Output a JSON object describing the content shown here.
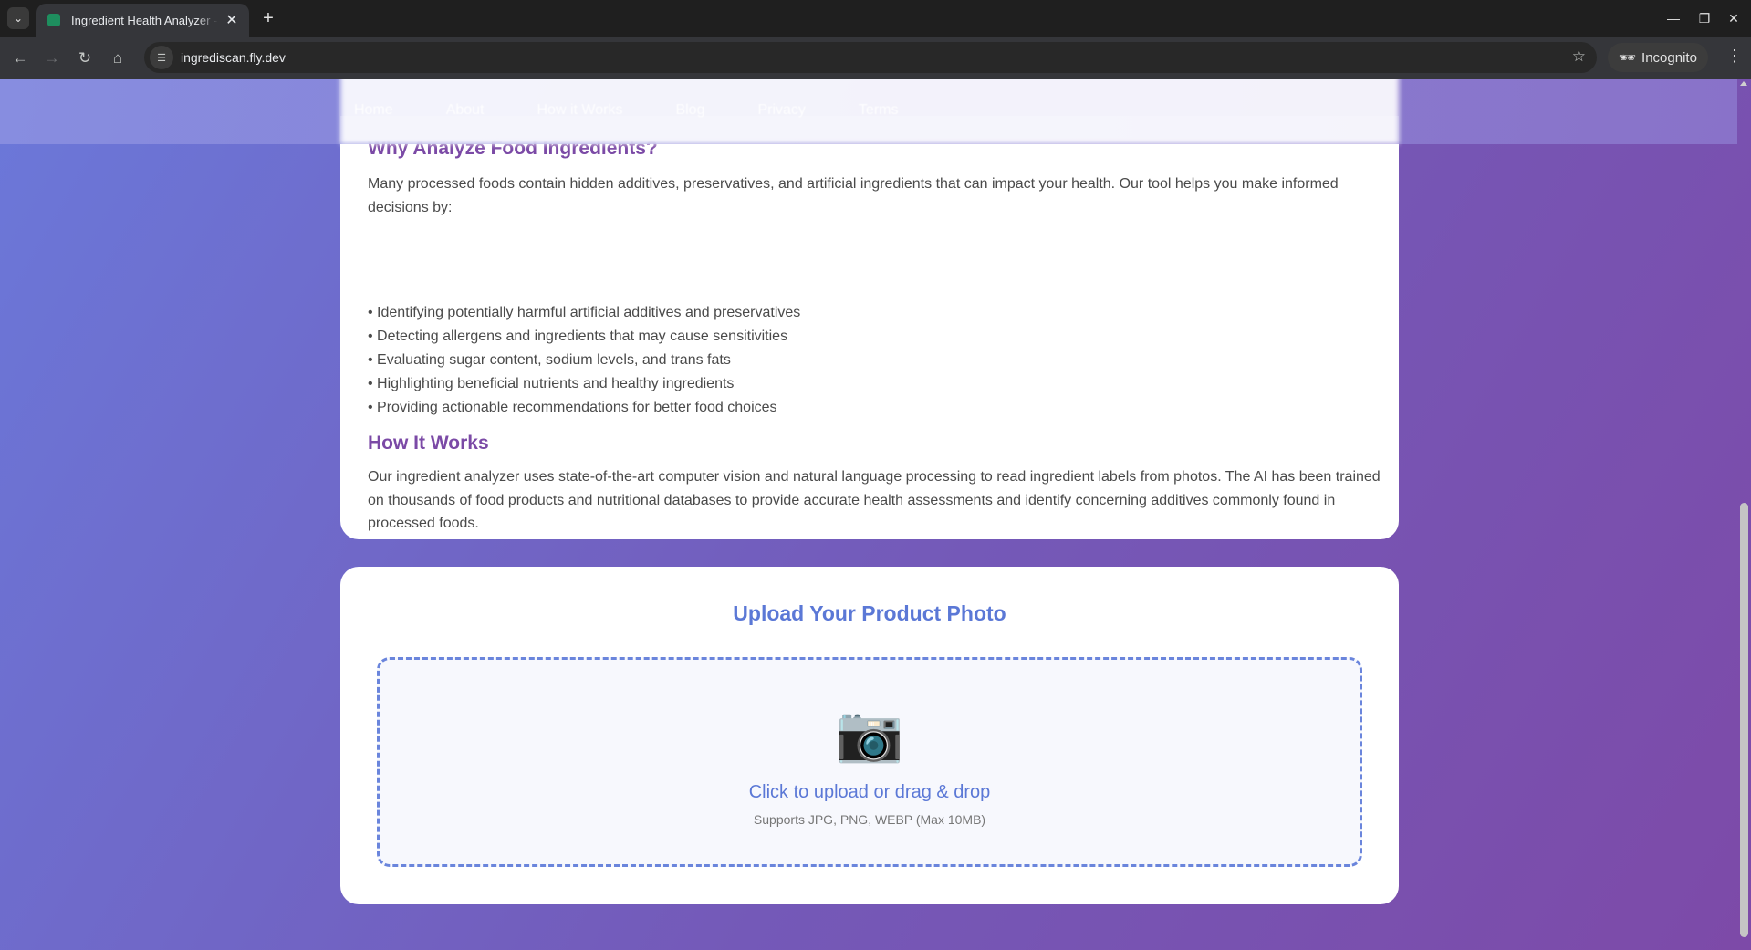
{
  "browser": {
    "tab_title": "Ingredient Health Analyzer - ",
    "url": "ingrediscan.fly.dev",
    "incognito_label": "Incognito"
  },
  "nav": {
    "links": [
      "Home",
      "About",
      "How it Works",
      "Blog",
      "Privacy",
      "Terms"
    ]
  },
  "info": {
    "why_title": "Why Analyze Food Ingredients?",
    "why_intro": "Many processed foods contain hidden additives, preservatives, and artificial ingredients that can impact your health. Our tool helps you make informed decisions by:",
    "bullets": [
      "• Identifying potentially harmful artificial additives and preservatives",
      "• Detecting allergens and ingredients that may cause sensitivities",
      "• Evaluating sugar content, sodium levels, and trans fats",
      "• Highlighting beneficial nutrients and healthy ingredients",
      "• Providing actionable recommendations for better food choices"
    ],
    "how_title": "How It Works",
    "how_text": "Our ingredient analyzer uses state-of-the-art computer vision and natural language processing to read ingredient labels from photos. The AI has been trained on thousands of food products and nutritional databases to provide accurate health assessments and identify concerning additives commonly found in processed foods."
  },
  "upload": {
    "title": "Upload Your Product Photo",
    "camera_glyph": "📷",
    "cta": "Click to upload or drag & drop",
    "supports": "Supports JPG, PNG, WEBP (Max 10MB)"
  },
  "icons": {
    "tab_list": "chevron-down-icon",
    "upload": "camera-icon"
  },
  "colors": {
    "accent_purple": "#7b4aa6",
    "accent_blue": "#5b78d6",
    "bg_gradient_start": "#6b78d9",
    "bg_gradient_end": "#7d4aa8"
  }
}
